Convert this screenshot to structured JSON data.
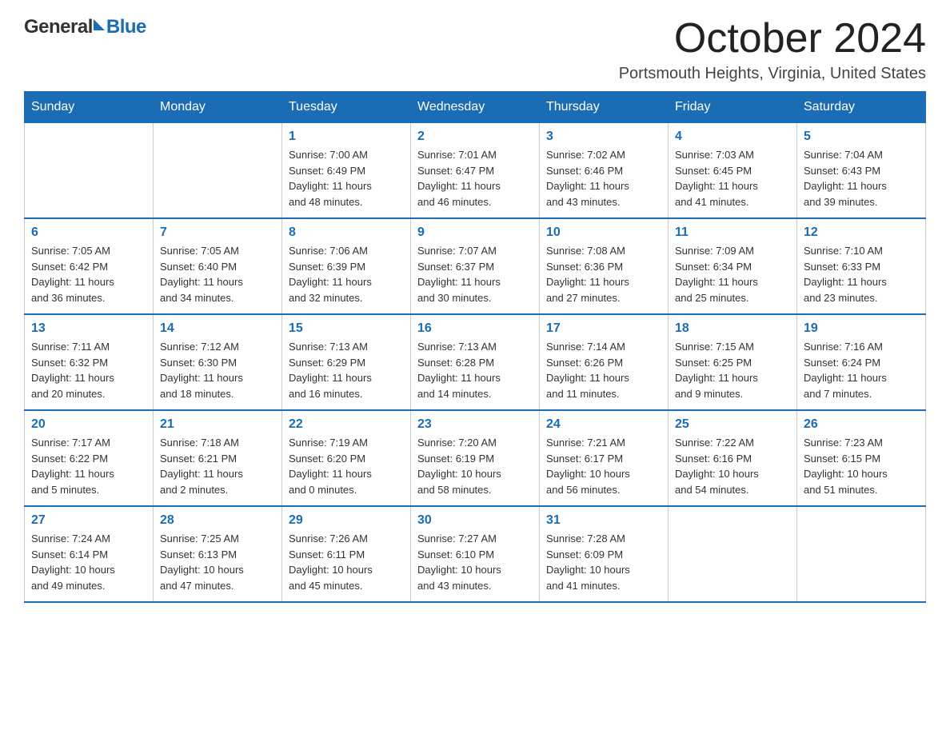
{
  "logo": {
    "general": "General",
    "blue": "Blue"
  },
  "title": "October 2024",
  "location": "Portsmouth Heights, Virginia, United States",
  "days_of_week": [
    "Sunday",
    "Monday",
    "Tuesday",
    "Wednesday",
    "Thursday",
    "Friday",
    "Saturday"
  ],
  "weeks": [
    [
      {
        "day": "",
        "info": ""
      },
      {
        "day": "",
        "info": ""
      },
      {
        "day": "1",
        "info": "Sunrise: 7:00 AM\nSunset: 6:49 PM\nDaylight: 11 hours\nand 48 minutes."
      },
      {
        "day": "2",
        "info": "Sunrise: 7:01 AM\nSunset: 6:47 PM\nDaylight: 11 hours\nand 46 minutes."
      },
      {
        "day": "3",
        "info": "Sunrise: 7:02 AM\nSunset: 6:46 PM\nDaylight: 11 hours\nand 43 minutes."
      },
      {
        "day": "4",
        "info": "Sunrise: 7:03 AM\nSunset: 6:45 PM\nDaylight: 11 hours\nand 41 minutes."
      },
      {
        "day": "5",
        "info": "Sunrise: 7:04 AM\nSunset: 6:43 PM\nDaylight: 11 hours\nand 39 minutes."
      }
    ],
    [
      {
        "day": "6",
        "info": "Sunrise: 7:05 AM\nSunset: 6:42 PM\nDaylight: 11 hours\nand 36 minutes."
      },
      {
        "day": "7",
        "info": "Sunrise: 7:05 AM\nSunset: 6:40 PM\nDaylight: 11 hours\nand 34 minutes."
      },
      {
        "day": "8",
        "info": "Sunrise: 7:06 AM\nSunset: 6:39 PM\nDaylight: 11 hours\nand 32 minutes."
      },
      {
        "day": "9",
        "info": "Sunrise: 7:07 AM\nSunset: 6:37 PM\nDaylight: 11 hours\nand 30 minutes."
      },
      {
        "day": "10",
        "info": "Sunrise: 7:08 AM\nSunset: 6:36 PM\nDaylight: 11 hours\nand 27 minutes."
      },
      {
        "day": "11",
        "info": "Sunrise: 7:09 AM\nSunset: 6:34 PM\nDaylight: 11 hours\nand 25 minutes."
      },
      {
        "day": "12",
        "info": "Sunrise: 7:10 AM\nSunset: 6:33 PM\nDaylight: 11 hours\nand 23 minutes."
      }
    ],
    [
      {
        "day": "13",
        "info": "Sunrise: 7:11 AM\nSunset: 6:32 PM\nDaylight: 11 hours\nand 20 minutes."
      },
      {
        "day": "14",
        "info": "Sunrise: 7:12 AM\nSunset: 6:30 PM\nDaylight: 11 hours\nand 18 minutes."
      },
      {
        "day": "15",
        "info": "Sunrise: 7:13 AM\nSunset: 6:29 PM\nDaylight: 11 hours\nand 16 minutes."
      },
      {
        "day": "16",
        "info": "Sunrise: 7:13 AM\nSunset: 6:28 PM\nDaylight: 11 hours\nand 14 minutes."
      },
      {
        "day": "17",
        "info": "Sunrise: 7:14 AM\nSunset: 6:26 PM\nDaylight: 11 hours\nand 11 minutes."
      },
      {
        "day": "18",
        "info": "Sunrise: 7:15 AM\nSunset: 6:25 PM\nDaylight: 11 hours\nand 9 minutes."
      },
      {
        "day": "19",
        "info": "Sunrise: 7:16 AM\nSunset: 6:24 PM\nDaylight: 11 hours\nand 7 minutes."
      }
    ],
    [
      {
        "day": "20",
        "info": "Sunrise: 7:17 AM\nSunset: 6:22 PM\nDaylight: 11 hours\nand 5 minutes."
      },
      {
        "day": "21",
        "info": "Sunrise: 7:18 AM\nSunset: 6:21 PM\nDaylight: 11 hours\nand 2 minutes."
      },
      {
        "day": "22",
        "info": "Sunrise: 7:19 AM\nSunset: 6:20 PM\nDaylight: 11 hours\nand 0 minutes."
      },
      {
        "day": "23",
        "info": "Sunrise: 7:20 AM\nSunset: 6:19 PM\nDaylight: 10 hours\nand 58 minutes."
      },
      {
        "day": "24",
        "info": "Sunrise: 7:21 AM\nSunset: 6:17 PM\nDaylight: 10 hours\nand 56 minutes."
      },
      {
        "day": "25",
        "info": "Sunrise: 7:22 AM\nSunset: 6:16 PM\nDaylight: 10 hours\nand 54 minutes."
      },
      {
        "day": "26",
        "info": "Sunrise: 7:23 AM\nSunset: 6:15 PM\nDaylight: 10 hours\nand 51 minutes."
      }
    ],
    [
      {
        "day": "27",
        "info": "Sunrise: 7:24 AM\nSunset: 6:14 PM\nDaylight: 10 hours\nand 49 minutes."
      },
      {
        "day": "28",
        "info": "Sunrise: 7:25 AM\nSunset: 6:13 PM\nDaylight: 10 hours\nand 47 minutes."
      },
      {
        "day": "29",
        "info": "Sunrise: 7:26 AM\nSunset: 6:11 PM\nDaylight: 10 hours\nand 45 minutes."
      },
      {
        "day": "30",
        "info": "Sunrise: 7:27 AM\nSunset: 6:10 PM\nDaylight: 10 hours\nand 43 minutes."
      },
      {
        "day": "31",
        "info": "Sunrise: 7:28 AM\nSunset: 6:09 PM\nDaylight: 10 hours\nand 41 minutes."
      },
      {
        "day": "",
        "info": ""
      },
      {
        "day": "",
        "info": ""
      }
    ]
  ]
}
